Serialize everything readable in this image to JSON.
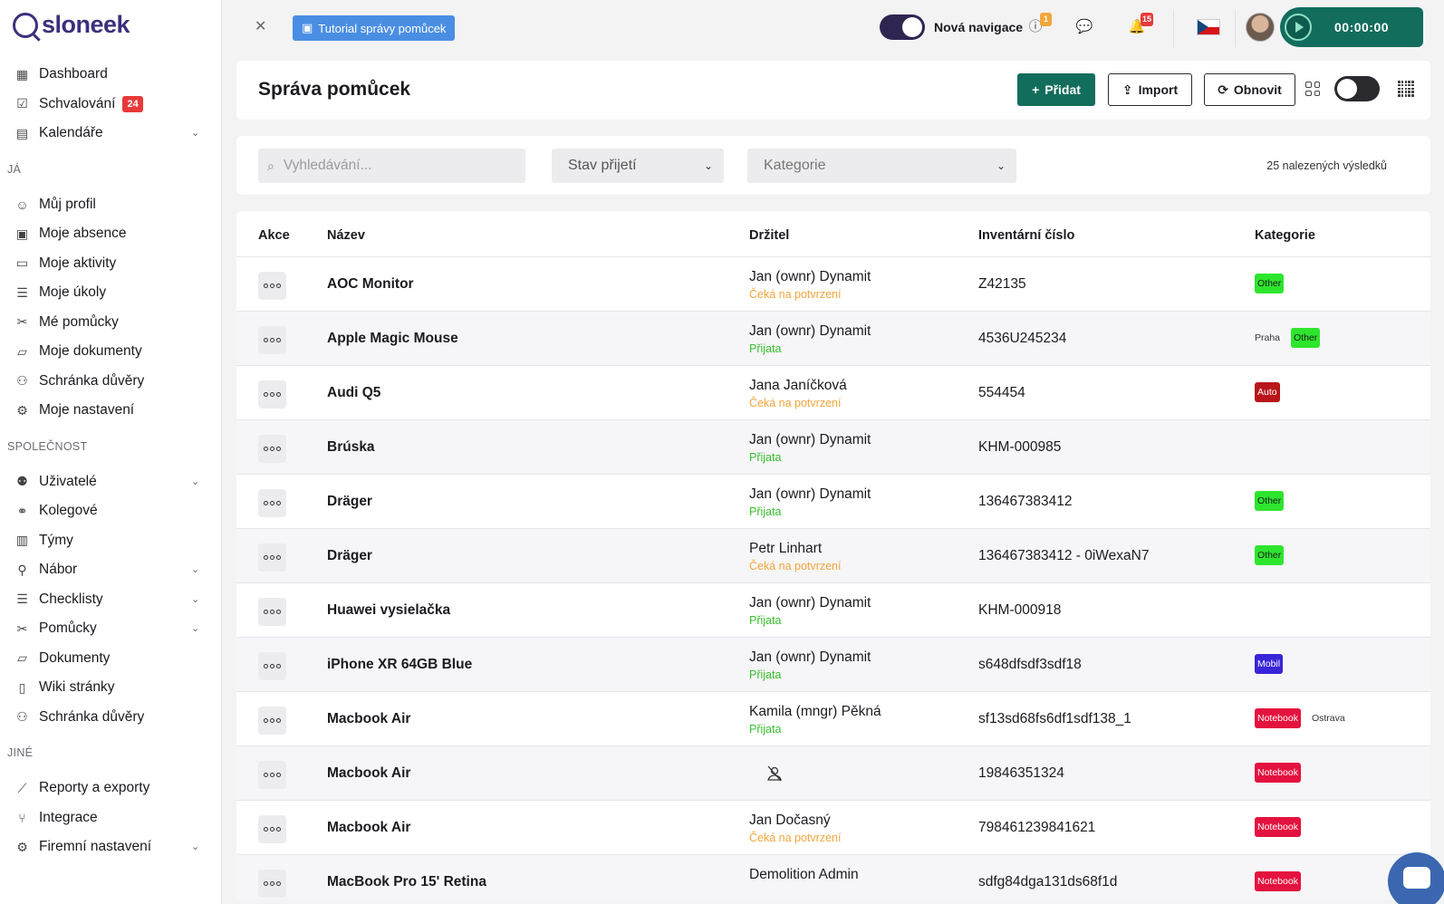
{
  "app": {
    "logo_text": "sloneek"
  },
  "sidebar": {
    "top_items": [
      {
        "label": "Dashboard",
        "icon": "dashboard-icon"
      },
      {
        "label": "Schvalování",
        "icon": "approval-icon",
        "badge": "24"
      },
      {
        "label": "Kalendáře",
        "icon": "calendar-icon",
        "has_chevron": true
      }
    ],
    "section_me": "JÁ",
    "me_items": [
      {
        "label": "Můj profil",
        "icon": "user-icon"
      },
      {
        "label": "Moje absence",
        "icon": "absence-icon"
      },
      {
        "label": "Moje aktivity",
        "icon": "book-icon"
      },
      {
        "label": "Moje úkoly",
        "icon": "tasks-icon"
      },
      {
        "label": "Mé pomůcky",
        "icon": "tools-icon"
      },
      {
        "label": "Moje dokumenty",
        "icon": "folder-icon"
      },
      {
        "label": "Schránka důvěry",
        "icon": "trust-box-icon"
      },
      {
        "label": "Moje nastavení",
        "icon": "gear-icon"
      }
    ],
    "section_company": "SPOLEČNOST",
    "company_items": [
      {
        "label": "Uživatelé",
        "icon": "users-icon",
        "has_chevron": true
      },
      {
        "label": "Kolegové",
        "icon": "colleagues-icon"
      },
      {
        "label": "Týmy",
        "icon": "teams-icon"
      },
      {
        "label": "Nábor",
        "icon": "recruitment-icon",
        "has_chevron": true
      },
      {
        "label": "Checklisty",
        "icon": "checklist-icon",
        "has_chevron": true
      },
      {
        "label": "Pomůcky",
        "icon": "tools-icon",
        "has_chevron": true
      },
      {
        "label": "Dokumenty",
        "icon": "folder-icon"
      },
      {
        "label": "Wiki stránky",
        "icon": "wiki-icon"
      },
      {
        "label": "Schránka důvěry",
        "icon": "trust-box-icon"
      }
    ],
    "section_other": "JINÉ",
    "other_items": [
      {
        "label": "Reporty a exporty",
        "icon": "chart-icon"
      },
      {
        "label": "Integrace",
        "icon": "integration-icon"
      },
      {
        "label": "Firemní nastavení",
        "icon": "gear-icon",
        "has_chevron": true
      }
    ]
  },
  "topbar": {
    "tutorial_label": "Tutorial správy pomůcek",
    "new_nav_label": "Nová navigace",
    "info_badge": "1",
    "notif_badge": "15",
    "timer": "00:00:00",
    "colors": {
      "info_badge": "#f2a53a",
      "notif_badge": "#e83a3a"
    }
  },
  "header": {
    "title": "Správa pomůcek",
    "add_label": "Přidat",
    "import_label": "Import",
    "refresh_label": "Obnovit"
  },
  "filters": {
    "search_placeholder": "Vyhledávání...",
    "status_label": "Stav přijetí",
    "category_label": "Kategorie",
    "results": "25 nalezených výsledků"
  },
  "table": {
    "columns": {
      "actions": "Akce",
      "name": "Název",
      "holder": "Držitel",
      "inventory": "Inventární číslo",
      "category": "Kategorie"
    },
    "rows": [
      {
        "name": "AOC Monitor",
        "holder": "Jan (ownr) Dynamit",
        "status": "Čeká na potvrzení",
        "status_type": "wait",
        "inventory": "Z42135",
        "tags": [
          {
            "label": "Other",
            "type": "other"
          }
        ]
      },
      {
        "name": "Apple Magic Mouse",
        "holder": "Jan (ownr) Dynamit",
        "status": "Přijata",
        "status_type": "ok",
        "inventory": "4536U245234",
        "location_before": "Praha",
        "tags": [
          {
            "label": "Other",
            "type": "other"
          }
        ]
      },
      {
        "name": "Audi Q5",
        "holder": "Jana Janíčková",
        "status": "Čeká na potvrzení",
        "status_type": "wait",
        "inventory": "554454",
        "tags": [
          {
            "label": "Auto",
            "type": "auto"
          }
        ]
      },
      {
        "name": "Brúska",
        "holder": "Jan (ownr) Dynamit",
        "status": "Přijata",
        "status_type": "ok",
        "inventory": "KHM-000985",
        "tags": []
      },
      {
        "name": "Dräger",
        "holder": "Jan (ownr) Dynamit",
        "status": "Přijata",
        "status_type": "ok",
        "inventory": "136467383412",
        "tags": [
          {
            "label": "Other",
            "type": "other"
          }
        ]
      },
      {
        "name": "Dräger",
        "holder": "Petr Linhart",
        "status": "Čeká na potvrzení",
        "status_type": "wait",
        "inventory": "136467383412 - 0iWexaN7",
        "tags": [
          {
            "label": "Other",
            "type": "other"
          }
        ]
      },
      {
        "name": "Huawei vysielačka",
        "holder": "Jan (ownr) Dynamit",
        "status": "Přijata",
        "status_type": "ok",
        "inventory": "KHM-000918",
        "tags": []
      },
      {
        "name": "iPhone XR 64GB Blue",
        "holder": "Jan (ownr) Dynamit",
        "status": "Přijata",
        "status_type": "ok",
        "inventory": "s648dfsdf3sdf18",
        "tags": [
          {
            "label": "Mobil",
            "type": "mobil"
          }
        ]
      },
      {
        "name": "Macbook Air",
        "holder": "Kamila (mngr) Pěkná",
        "status": "Přijata",
        "status_type": "ok",
        "inventory": "sf13sd68fs6df1sdf138_1",
        "tags": [
          {
            "label": "Notebook",
            "type": "notebook"
          }
        ],
        "location_after": "Ostrava"
      },
      {
        "name": "Macbook Air",
        "holder": "",
        "status": "",
        "status_type": "none",
        "inventory": "19846351324",
        "tags": [
          {
            "label": "Notebook",
            "type": "notebook"
          }
        ]
      },
      {
        "name": "Macbook Air",
        "holder": "Jan Dočasný",
        "status": "Čeká na potvrzení",
        "status_type": "wait",
        "inventory": "798461239841621",
        "tags": [
          {
            "label": "Notebook",
            "type": "notebook"
          }
        ]
      },
      {
        "name": "MacBook Pro 15' Retina",
        "holder": "Demolition Admin",
        "status": "",
        "status_type": "wait",
        "inventory": "sdfg84dga131ds68f1d",
        "tags": [
          {
            "label": "Notebook",
            "type": "notebook"
          }
        ]
      }
    ]
  }
}
